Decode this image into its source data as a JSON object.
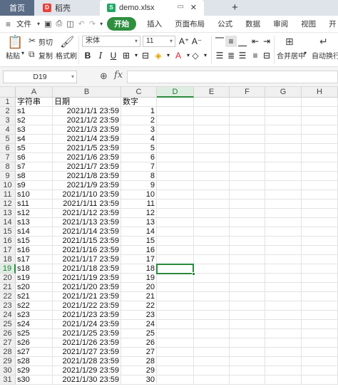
{
  "tabs": {
    "home": "首页",
    "doc": "稻壳",
    "doc_icon": "D",
    "active": "demo.xlsx",
    "active_icon": "S",
    "new_tab": "+"
  },
  "menubar": {
    "file": "文件",
    "items": [
      "开始",
      "插入",
      "页面布局",
      "公式",
      "数据",
      "审阅",
      "视图",
      "开"
    ]
  },
  "ribbon": {
    "paste": "粘贴",
    "cut": "剪切",
    "copy": "复制",
    "format_painter": "格式刷",
    "font_name": "宋体",
    "font_size": "11",
    "merge_center": "合并居中",
    "auto_wrap": "自动换行",
    "accent_color": "#2f8f3f"
  },
  "formula_bar": {
    "cell_ref": "D19",
    "fx": "fx",
    "content": ""
  },
  "sheet": {
    "columns": [
      "A",
      "B",
      "C",
      "D",
      "E",
      "F",
      "G",
      "H"
    ],
    "selected_column": "D",
    "selected_row": "19",
    "selected_cell": "D19",
    "headers": [
      "字符串",
      "日期",
      "数字"
    ],
    "rows": [
      [
        "s1",
        "2021/1/1  23:59",
        "1"
      ],
      [
        "s2",
        "2021/1/2  23:59",
        "2"
      ],
      [
        "s3",
        "2021/1/3  23:59",
        "3"
      ],
      [
        "s4",
        "2021/1/4  23:59",
        "4"
      ],
      [
        "s5",
        "2021/1/5  23:59",
        "5"
      ],
      [
        "s6",
        "2021/1/6  23:59",
        "6"
      ],
      [
        "s7",
        "2021/1/7  23:59",
        "7"
      ],
      [
        "s8",
        "2021/1/8  23:59",
        "8"
      ],
      [
        "s9",
        "2021/1/9  23:59",
        "9"
      ],
      [
        "s10",
        "2021/1/10  23:59",
        "10"
      ],
      [
        "s11",
        "2021/1/11  23:59",
        "11"
      ],
      [
        "s12",
        "2021/1/12  23:59",
        "12"
      ],
      [
        "s13",
        "2021/1/13  23:59",
        "13"
      ],
      [
        "s14",
        "2021/1/14  23:59",
        "14"
      ],
      [
        "s15",
        "2021/1/15  23:59",
        "15"
      ],
      [
        "s16",
        "2021/1/16  23:59",
        "16"
      ],
      [
        "s17",
        "2021/1/17  23:59",
        "17"
      ],
      [
        "s18",
        "2021/1/18  23:59",
        "18"
      ],
      [
        "s19",
        "2021/1/19  23:59",
        "19"
      ],
      [
        "s20",
        "2021/1/20  23:59",
        "20"
      ],
      [
        "s21",
        "2021/1/21  23:59",
        "21"
      ],
      [
        "s22",
        "2021/1/22  23:59",
        "22"
      ],
      [
        "s23",
        "2021/1/23  23:59",
        "23"
      ],
      [
        "s24",
        "2021/1/24  23:59",
        "24"
      ],
      [
        "s25",
        "2021/1/25  23:59",
        "25"
      ],
      [
        "s26",
        "2021/1/26  23:59",
        "26"
      ],
      [
        "s27",
        "2021/1/27  23:59",
        "27"
      ],
      [
        "s28",
        "2021/1/28  23:59",
        "28"
      ],
      [
        "s29",
        "2021/1/29  23:59",
        "29"
      ],
      [
        "s30",
        "2021/1/30  23:59",
        "30"
      ]
    ]
  }
}
